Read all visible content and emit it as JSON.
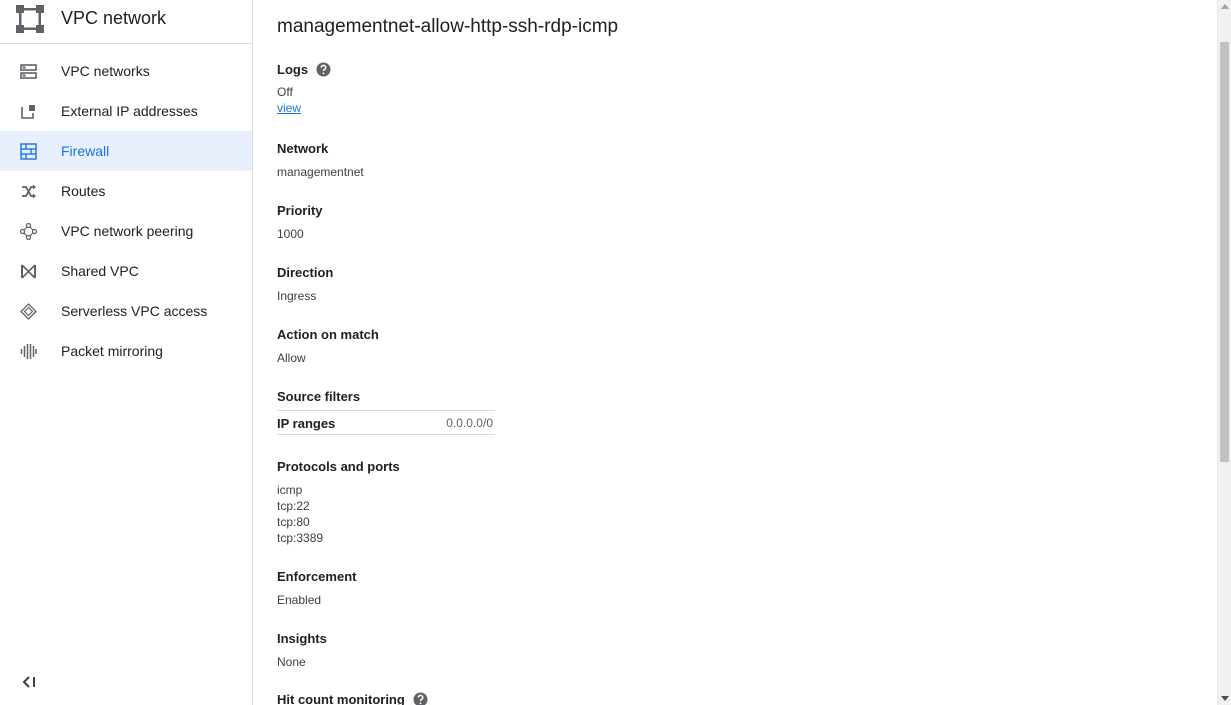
{
  "sidebar": {
    "title": "VPC network",
    "items": [
      {
        "label": "VPC networks",
        "icon": "vpc-networks-icon"
      },
      {
        "label": "External IP addresses",
        "icon": "external-ip-icon"
      },
      {
        "label": "Firewall",
        "icon": "firewall-icon",
        "active": true
      },
      {
        "label": "Routes",
        "icon": "routes-icon"
      },
      {
        "label": "VPC network peering",
        "icon": "peering-icon"
      },
      {
        "label": "Shared VPC",
        "icon": "shared-vpc-icon"
      },
      {
        "label": "Serverless VPC access",
        "icon": "serverless-icon"
      },
      {
        "label": "Packet mirroring",
        "icon": "packet-mirroring-icon"
      }
    ]
  },
  "main": {
    "title": "managementnet-allow-http-ssh-rdp-icmp",
    "logs": {
      "label": "Logs",
      "value": "Off",
      "link": "view"
    },
    "network": {
      "label": "Network",
      "value": "managementnet"
    },
    "priority": {
      "label": "Priority",
      "value": "1000"
    },
    "direction": {
      "label": "Direction",
      "value": "Ingress"
    },
    "action": {
      "label": "Action on match",
      "value": "Allow"
    },
    "source_filters": {
      "label": "Source filters",
      "key": "IP ranges",
      "value": "0.0.0.0/0"
    },
    "protocols": {
      "label": "Protocols and ports",
      "items": [
        "icmp",
        "tcp:22",
        "tcp:80",
        "tcp:3389"
      ]
    },
    "enforcement": {
      "label": "Enforcement",
      "value": "Enabled"
    },
    "insights": {
      "label": "Insights",
      "value": "None"
    },
    "hit_count": {
      "label": "Hit count monitoring"
    }
  },
  "colors": {
    "accent": "#1a73e8",
    "active_bg": "#e8f0fe",
    "icon": "#5f6368"
  }
}
